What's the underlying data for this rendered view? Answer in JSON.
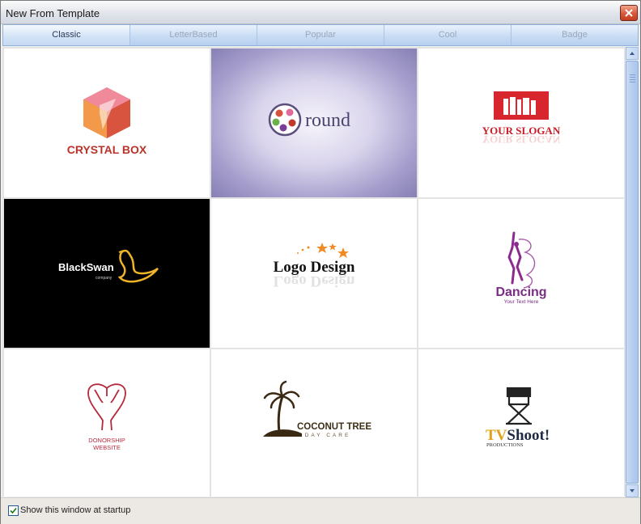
{
  "window": {
    "title": "New From Template"
  },
  "tabs": [
    {
      "label": "Classic",
      "active": true
    },
    {
      "label": "LetterBased",
      "active": false
    },
    {
      "label": "Popular",
      "active": false
    },
    {
      "label": "Cool",
      "active": false
    },
    {
      "label": "Badge",
      "active": false
    }
  ],
  "templates": [
    {
      "name": "crystal-box",
      "text": "CRYSTAL BOX",
      "icon": "cube-icon",
      "background": "#ffffff"
    },
    {
      "name": "round",
      "text": "round",
      "icon": "circle-dots-icon",
      "background": "#8a82b8"
    },
    {
      "name": "your-slogan",
      "text": "YOUR SLOGAN",
      "icon": "books-icon",
      "background": "#ffffff"
    },
    {
      "name": "black-swan",
      "text": "BlackSwan",
      "subtext": "company",
      "icon": "swan-icon",
      "background": "#000000"
    },
    {
      "name": "logo-design",
      "text": "Logo Design",
      "icon": "stars-icon",
      "background": "#ffffff"
    },
    {
      "name": "dancing",
      "text": "Dancing",
      "subtext": "Your Text Here",
      "icon": "dancer-icon",
      "background": "#ffffff"
    },
    {
      "name": "donorship",
      "text": "DONORSHIP",
      "subtext": "WEBSITE",
      "icon": "flamingo-heart-icon",
      "background": "#ffffff"
    },
    {
      "name": "coconut-tree",
      "text": "COCONUT TREE",
      "subtext": "DAY CARE",
      "icon": "palm-tree-icon",
      "background": "#ffffff"
    },
    {
      "name": "tv-shoot",
      "text": "TV",
      "text2": "Shoot!",
      "subtext": "PRODUCTIONS",
      "icon": "director-chair-icon",
      "background": "#ffffff"
    }
  ],
  "startup_checkbox": {
    "label": "Show this window at startup",
    "checked": true
  },
  "colors": {
    "accent": "#c6dbf4",
    "close": "#d9583a"
  }
}
